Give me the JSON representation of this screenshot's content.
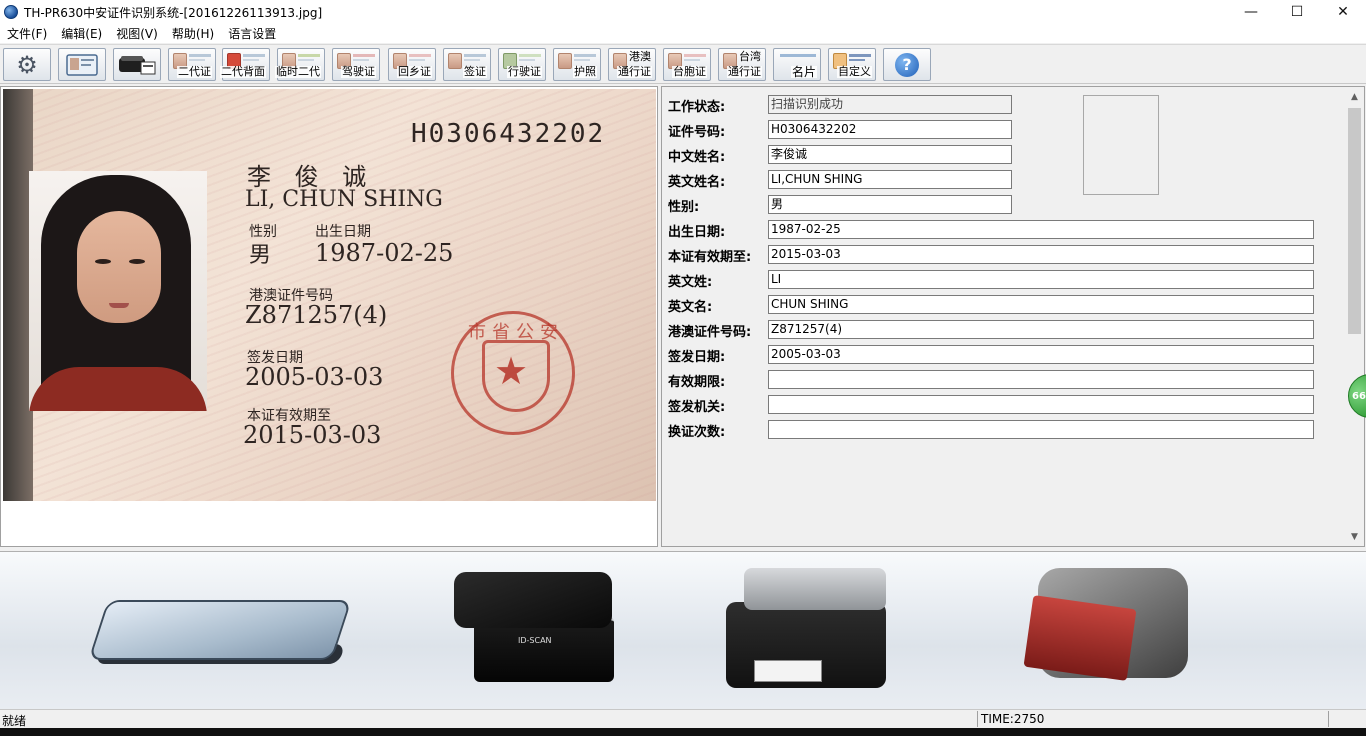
{
  "window": {
    "title": "TH-PR630中安证件识别系统-[20161226113913.jpg]",
    "controls": {
      "minimize": "—",
      "maximize": "☐",
      "close": "✕"
    }
  },
  "menu": [
    "文件(F)",
    "编辑(E)",
    "视图(V)",
    "帮助(H)",
    "语言设置"
  ],
  "toolbar": {
    "buttons": [
      {
        "id": "settings",
        "label": "",
        "icon": "gear-icon"
      },
      {
        "id": "scan",
        "label": "",
        "icon": "scan-card-icon"
      },
      {
        "id": "device",
        "label": "",
        "icon": "reader-device-icon"
      },
      {
        "id": "id2",
        "label": "二代证"
      },
      {
        "id": "id2back",
        "label": "二代背面"
      },
      {
        "id": "tempid",
        "label": "临时二代"
      },
      {
        "id": "driver",
        "label": "驾驶证"
      },
      {
        "id": "homereturn",
        "label": "回乡证"
      },
      {
        "id": "visa",
        "label": "签证"
      },
      {
        "id": "vehicle",
        "label": "行驶证"
      },
      {
        "id": "passport",
        "label": "护照"
      },
      {
        "id": "hkmo",
        "label_top": "港澳",
        "label": "通行证"
      },
      {
        "id": "taiwan_compat",
        "label": "台胞证"
      },
      {
        "id": "taiwan",
        "label_top": "台湾",
        "label": "通行证"
      },
      {
        "id": "namecard",
        "label": "名片"
      },
      {
        "id": "custom",
        "label": "自定义"
      },
      {
        "id": "help",
        "label": "",
        "icon": "help-icon",
        "glyph": "?"
      }
    ]
  },
  "card_image": {
    "doc_number": "H0306432202",
    "name_cn": "李 俊 诚",
    "name_en": "LI, CHUN SHING",
    "sex_label": "性别",
    "sex_value": "男",
    "birth_label": "出生日期",
    "birth_value": "1987-02-25",
    "hkmo_no_label": "港澳证件号码",
    "hkmo_no_value": "Z871257(4)",
    "issue_label": "签发日期",
    "issue_value": "2005-03-03",
    "expiry_label": "本证有效期至",
    "expiry_value": "2015-03-03",
    "stamp_star": "★",
    "stamp_text": "市省公安"
  },
  "form": {
    "fields": [
      {
        "label": "工作状态:",
        "value": "扫描识别成功"
      },
      {
        "label": "证件号码:",
        "value": "H0306432202"
      },
      {
        "label": "中文姓名:",
        "value": "李俊诚"
      },
      {
        "label": "英文姓名:",
        "value": "LI,CHUN SHING"
      },
      {
        "label": "性别:",
        "value": "男"
      },
      {
        "label": "出生日期:",
        "value": "1987-02-25"
      },
      {
        "label": "本证有效期至:",
        "value": "2015-03-03"
      },
      {
        "label": "英文姓:",
        "value": "LI"
      },
      {
        "label": "英文名:",
        "value": "CHUN SHING"
      },
      {
        "label": "港澳证件号码:",
        "value": "Z871257(4)"
      },
      {
        "label": "签发日期:",
        "value": "2005-03-03"
      },
      {
        "label": "有效期限:",
        "value": ""
      },
      {
        "label": "签发机关:",
        "value": ""
      },
      {
        "label": "换证次数:",
        "value": ""
      }
    ],
    "scroll_up": "▲",
    "scroll_down": "▼",
    "badge": "66"
  },
  "banner": {
    "devices": [
      "flatbed-scanner",
      "card-reader",
      "document-scanner",
      "passport-reader"
    ],
    "reader_brand": "ID-SCAN"
  },
  "status": {
    "left": "就绪",
    "time": "TIME:2750"
  }
}
